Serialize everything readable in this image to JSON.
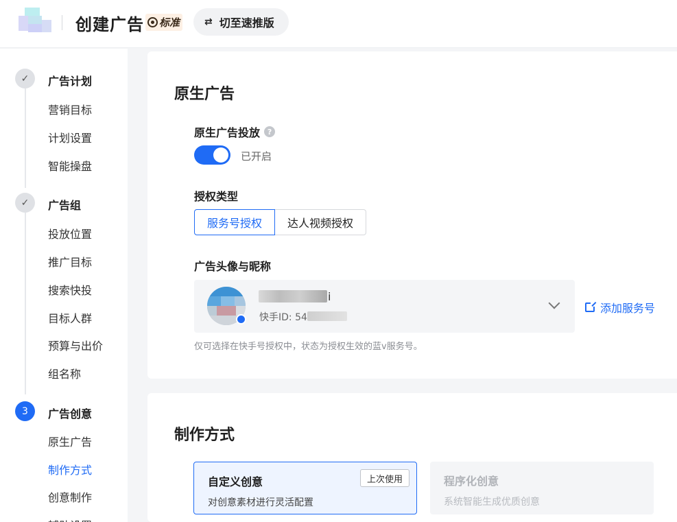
{
  "header": {
    "title": "创建广告",
    "badge": "标准",
    "switch_label": "切至速推版",
    "switch_icon": "swap-arrows-icon"
  },
  "sidebar": {
    "steps": [
      {
        "status": "done",
        "marker": "✓",
        "title": "广告计划",
        "items": [
          "营销目标",
          "计划设置",
          "智能操盘"
        ]
      },
      {
        "status": "done",
        "marker": "✓",
        "title": "广告组",
        "items": [
          "投放位置",
          "推广目标",
          "搜索快投",
          "目标人群",
          "预算与出价",
          "组名称"
        ]
      },
      {
        "status": "active",
        "marker": "3",
        "title": "广告创意",
        "items": [
          "原生广告",
          "制作方式",
          "创意制作",
          "辅助设置"
        ],
        "current_item": "制作方式"
      }
    ]
  },
  "native_ad": {
    "section_title": "原生广告",
    "delivery_label": "原生广告投放",
    "help_glyph": "?",
    "toggle_on": true,
    "toggle_text": "已开启",
    "auth_type_label": "授权类型",
    "auth_options": [
      "服务号授权",
      "达人视频授权"
    ],
    "auth_selected": "服务号授权",
    "avatar_label": "广告头像与昵称",
    "account_name_tail": "i",
    "account_id_prefix": "快手ID: 54",
    "add_link": "添加服务号",
    "hint": "仅可选择在快手号授权中，状态为授权生效的蓝v服务号。"
  },
  "production": {
    "section_title": "制作方式",
    "options": [
      {
        "title": "自定义创意",
        "desc": "对创意素材进行灵活配置",
        "badge": "上次使用",
        "selected": true
      },
      {
        "title": "程序化创意",
        "desc": "系统智能生成优质创意",
        "disabled": true
      }
    ]
  },
  "colors": {
    "primary": "#1f6bf5",
    "page_bg": "#f4f5f7"
  }
}
